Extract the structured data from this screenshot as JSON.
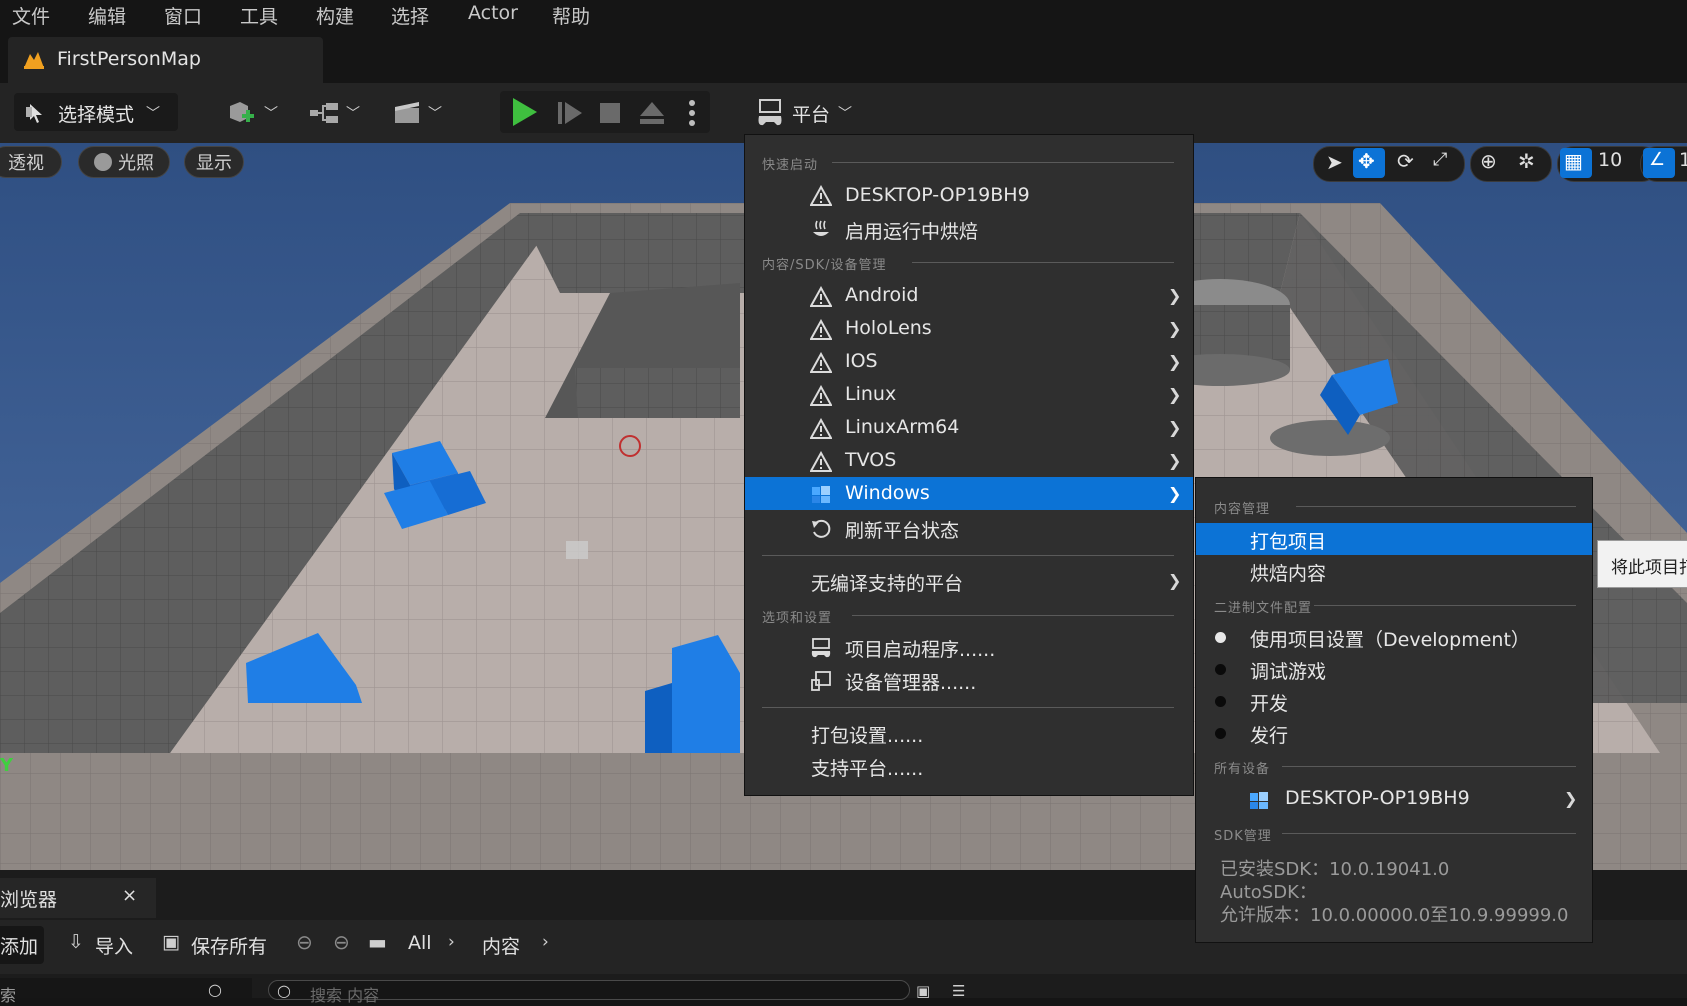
{
  "menubar": [
    "文件",
    "编辑",
    "窗口",
    "工具",
    "构建",
    "选择",
    "Actor",
    "帮助"
  ],
  "tab": {
    "title": "FirstPersonMap"
  },
  "toolbar": {
    "select_mode": "选择模式",
    "platform": "平台"
  },
  "viewport": {
    "perspective": "透视",
    "lighting": "光照",
    "show": "显示",
    "grid_value": "10",
    "axis_label": "Y",
    "right_clip": "1"
  },
  "platform_menu": {
    "quick_launch_header": "快速启动",
    "quick_launch": [
      "DESKTOP-OP19BH9",
      "启用运行中烘焙"
    ],
    "sdk_header": "内容/SDK/设备管理",
    "platforms": [
      "Android",
      "HoloLens",
      "IOS",
      "Linux",
      "LinuxArm64",
      "TVOS",
      "Windows"
    ],
    "refresh": "刷新平台状态",
    "unsupported": "无编译支持的平台",
    "options_header": "选项和设置",
    "options": [
      "项目启动程序......",
      "设备管理器......"
    ],
    "footer": [
      "打包设置......",
      "支持平台......"
    ]
  },
  "windows_submenu": {
    "content_header": "内容管理",
    "package": "打包项目",
    "cook": "烘焙内容",
    "binary_header": "二进制文件配置",
    "configs": [
      "使用项目设置（Development）",
      "调试游戏",
      "开发",
      "发行"
    ],
    "devices_header": "所有设备",
    "device": "DESKTOP-OP19BH9",
    "sdk_mgmt_header": "SDK管理",
    "sdk_lines": [
      "已安装SDK：10.0.19041.0",
      "AutoSDK：",
      "允许版本：10.0.00000.0至10.9.99999.0"
    ]
  },
  "tooltip": "将此项目打",
  "content_browser": {
    "tab": "浏览器",
    "close": "×",
    "add": "添加",
    "import": "导入",
    "save_all": "保存所有",
    "path": [
      "All",
      "内容"
    ],
    "search_left": "索",
    "search_placeholder": "搜索 内容"
  }
}
